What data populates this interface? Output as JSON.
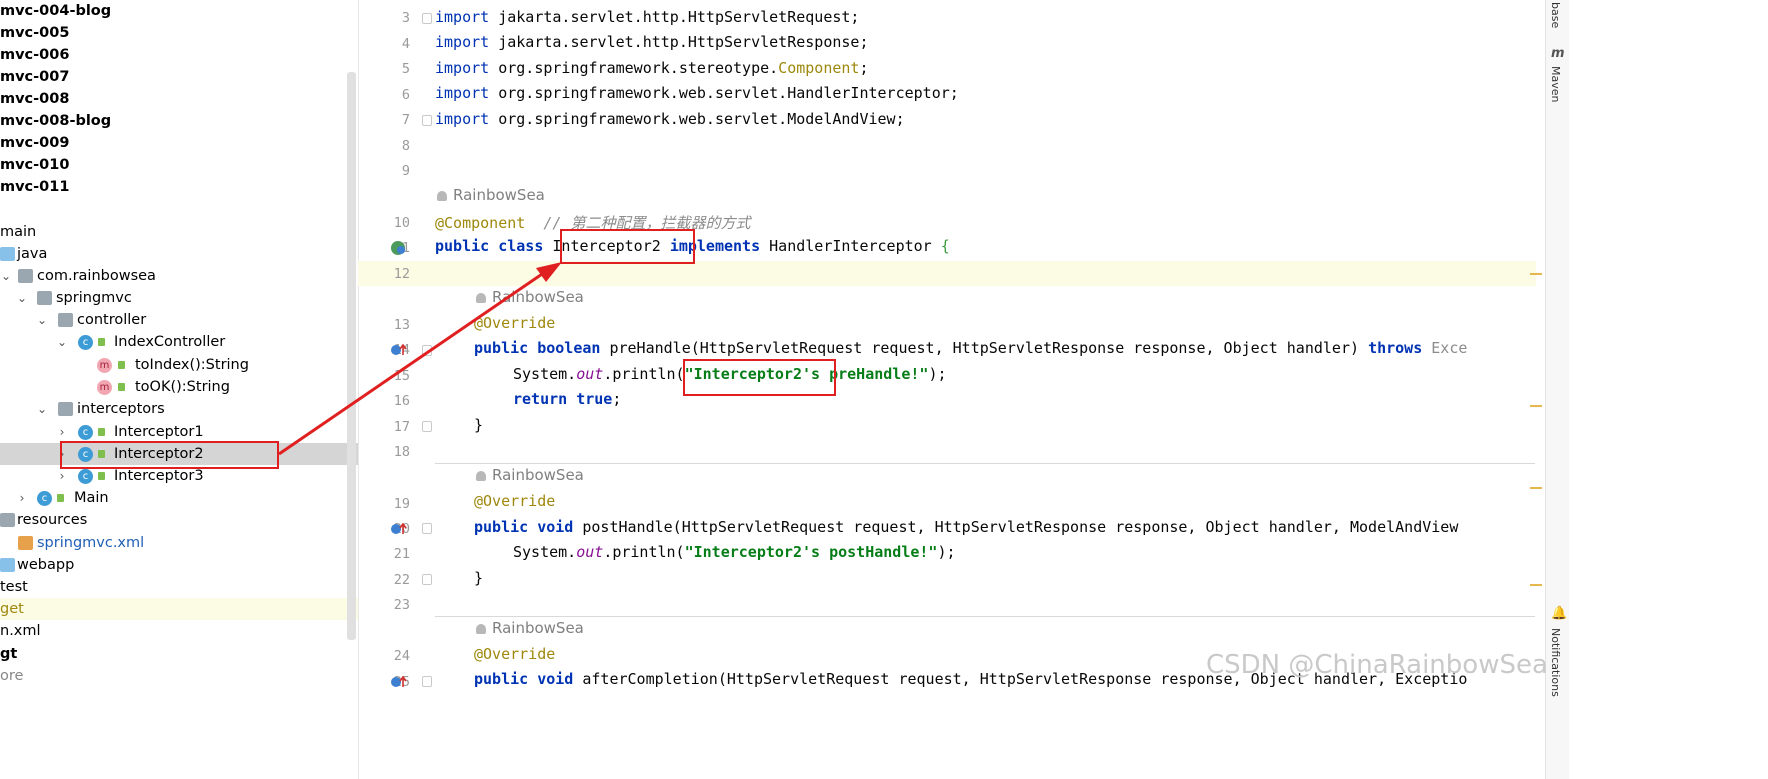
{
  "project_tree": {
    "items": [
      {
        "label": "mvc-004-blog",
        "bold": true
      },
      {
        "label": "mvc-005",
        "bold": true
      },
      {
        "label": "mvc-006",
        "bold": true
      },
      {
        "label": "mvc-007",
        "bold": true
      },
      {
        "label": "mvc-008",
        "bold": true
      },
      {
        "label": "mvc-008-blog",
        "bold": true
      },
      {
        "label": "mvc-009",
        "bold": true
      },
      {
        "label": "mvc-010",
        "bold": true
      },
      {
        "label": "mvc-011",
        "bold": true
      },
      {
        "label": "main",
        "bold": false
      },
      {
        "label": "java",
        "bold": false
      },
      {
        "label": "com.rainbowsea",
        "bold": false
      },
      {
        "label": "springmvc",
        "bold": false
      },
      {
        "label": "controller",
        "bold": false
      },
      {
        "label": "IndexController",
        "bold": false
      },
      {
        "label": "toIndex():String",
        "bold": false
      },
      {
        "label": "toOK():String",
        "bold": false
      },
      {
        "label": "interceptors",
        "bold": false
      },
      {
        "label": "Interceptor1",
        "bold": false
      },
      {
        "label": "Interceptor2",
        "bold": false
      },
      {
        "label": "Interceptor3",
        "bold": false
      },
      {
        "label": "Main",
        "bold": false
      },
      {
        "label": "resources",
        "bold": false
      },
      {
        "label": "springmvc.xml",
        "bold": false
      },
      {
        "label": "webapp",
        "bold": false
      },
      {
        "label": "test",
        "bold": false
      },
      {
        "label": "get",
        "bold": false
      },
      {
        "label": "n.xml",
        "bold": false
      },
      {
        "label": "gt",
        "bold": true
      },
      {
        "label": "ore",
        "bold": false
      }
    ],
    "selected": "Interceptor2"
  },
  "editor": {
    "line_numbers": [
      "3",
      "4",
      "5",
      "6",
      "7",
      "8",
      "9",
      "10",
      "11",
      "12",
      "13",
      "14",
      "15",
      "16",
      "17",
      "18",
      "19",
      "20",
      "21",
      "22",
      "23",
      "24",
      "25"
    ],
    "author": "RainbowSea",
    "code": {
      "l3_kw": "import",
      "l3_rest": " jakarta.servlet.http.HttpServletRequest;",
      "l4_kw": "import",
      "l4_rest": " jakarta.servlet.http.HttpServletResponse;",
      "l5_kw": "import",
      "l5_rest": " org.springframework.stereotype.",
      "l5_ann": "Component",
      "l5_end": ";",
      "l6_kw": "import",
      "l6_rest": " org.springframework.web.servlet.HandlerInterceptor;",
      "l7_kw": "import",
      "l7_rest": " org.springframework.web.servlet.ModelAndView;",
      "l10_ann": "@Component",
      "l10_cmt": "  // 第二种配置，拦截器的方式",
      "l11_kw1": "public",
      "l11_kw2": "class",
      "l11_name": "Interceptor2",
      "l11_kw3": "implements",
      "l11_rest": " HandlerInterceptor ",
      "l11_brace": "{",
      "l13_ann": "@Override",
      "l14_kw1": "public",
      "l14_kw2": "boolean",
      "l14_rest": " preHandle(HttpServletRequest request, HttpServletResponse response, Object handler) ",
      "l14_kw3": "throws",
      "l14_tail": " Exce",
      "l15_pre": "System.",
      "l15_out": "out",
      "l15_mid": ".println(",
      "l15_str": "\"Interceptor2's preHandle!\"",
      "l15_end": ");",
      "l16_kw1": "return",
      "l16_kw2": "true",
      "l16_end": ";",
      "l17": "}",
      "l19_ann": "@Override",
      "l20_kw1": "public",
      "l20_kw2": "void",
      "l20_rest": " postHandle(HttpServletRequest request, HttpServletResponse response, Object handler, ModelAndView",
      "l21_pre": "System.",
      "l21_out": "out",
      "l21_mid": ".println(",
      "l21_str": "\"Interceptor2's postHandle!\"",
      "l21_end": ");",
      "l22": "}",
      "l24_ann": "@Override",
      "l25_kw1": "public",
      "l25_kw2": "void",
      "l25_rest": " afterCompletion(HttpServletRequest request, HttpServletResponse response, Object handler, Exceptio"
    }
  },
  "right_sidebar": {
    "tabs": [
      "base",
      "Maven",
      "Notifications"
    ]
  },
  "watermark": "CSDN @ChinaRainbowSea",
  "colors": {
    "highlight_box": "#e02020",
    "arrow": "#e02020"
  }
}
